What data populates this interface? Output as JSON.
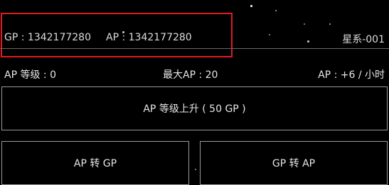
{
  "header": {
    "gp": "GP : 1342177280",
    "ap": "AP : 1342177280",
    "system": "星系-001"
  },
  "stats": {
    "ap_level": "AP 等级 : 0",
    "max_ap": "最大AP : 20",
    "ap_rate": "AP : +6 / 小时"
  },
  "buttons": {
    "upgrade": "AP 等级上升 ( 50 GP )",
    "ap_to_gp": "AP 转 GP",
    "gp_to_ap": "GP 转 AP"
  },
  "colors": {
    "background": "#000000",
    "highlight": "#e01b24",
    "text": "#e6e6e6",
    "border": "#9a9a9a"
  }
}
